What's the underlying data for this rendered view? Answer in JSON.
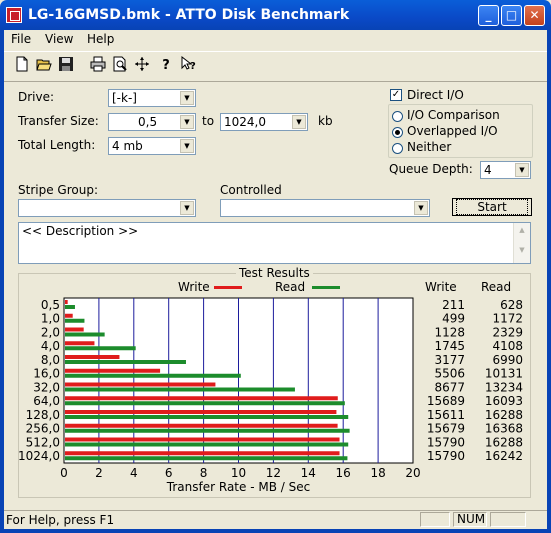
{
  "window": {
    "title": "LG-16GMSD.bmk - ATTO Disk Benchmark"
  },
  "menu": [
    "File",
    "View",
    "Help"
  ],
  "toolbar": [
    "new-icon",
    "open-icon",
    "save-icon",
    "print-icon",
    "print-preview-icon",
    "move-icon",
    "help-icon",
    "context-help-icon"
  ],
  "settings": {
    "drive_label": "Drive:",
    "drive_value": "[-k-]",
    "transfer_size_label": "Transfer Size:",
    "transfer_from": "0,5",
    "to_label": "to",
    "transfer_to": "1024,0",
    "kb_label": "kb",
    "total_length_label": "Total Length:",
    "total_length_value": "4 mb",
    "direct_io_label": "Direct I/O",
    "direct_io_checked": true,
    "options": [
      "I/O Comparison",
      "Overlapped I/O",
      "Neither"
    ],
    "selected_option": "Overlapped I/O",
    "queue_depth_label": "Queue Depth:",
    "queue_depth_value": "4",
    "stripe_group_label": "Stripe Group:",
    "stripe_group_value": "",
    "controlled_label": "Controlled",
    "controlled_value": "",
    "start_label": "Start",
    "description": "<< Description >>"
  },
  "results": {
    "title": "Test Results",
    "legend_write": "Write",
    "legend_read": "Read",
    "col_write": "Write",
    "col_read": "Read",
    "colors": {
      "write": "#e01c1c",
      "read": "#1c8c2c",
      "grid": "#1c1c9c"
    }
  },
  "chart_data": {
    "type": "bar",
    "orientation": "horizontal",
    "categories": [
      "0,5",
      "1,0",
      "2,0",
      "4,0",
      "8,0",
      "16,0",
      "32,0",
      "64,0",
      "128,0",
      "256,0",
      "512,0",
      "1024,0"
    ],
    "series": [
      {
        "name": "Write",
        "values": [
          211,
          499,
          1128,
          1745,
          3177,
          5506,
          8677,
          15689,
          15611,
          15679,
          15790,
          15790
        ]
      },
      {
        "name": "Read",
        "values": [
          628,
          1172,
          2329,
          4108,
          6990,
          10131,
          13234,
          16093,
          16288,
          16368,
          16288,
          16242
        ]
      }
    ],
    "xlabel": "Transfer Rate - MB / Sec",
    "xlim": [
      0,
      20
    ],
    "xticks": [
      0,
      2,
      4,
      6,
      8,
      10,
      12,
      14,
      16,
      18,
      20
    ],
    "grid": true
  },
  "status": {
    "text": "For Help, press F1",
    "num": "NUM"
  }
}
